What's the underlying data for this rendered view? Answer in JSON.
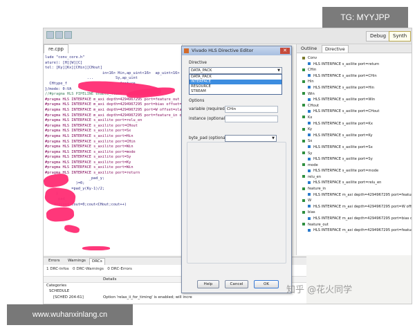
{
  "overlays": {
    "telegram": "TG: MYYJPP",
    "watermark": "知乎 @花火同学",
    "site": "www.wuhanxinlang.cn"
  },
  "toolbar": {
    "items": [
      "Debug",
      "Synth"
    ]
  },
  "editor": {
    "tab_label": "re.cpp",
    "lines": [
      "lude \"conv_core.h\"",
      "",
      "ature): [H][W][C]",
      "tel: [Ky][Kx][CHin][CHout]",
      "",
      "                          in<16> Hin,ap_uint<16>  ap_uint<16> ",
      "                   ...          Sy,ap_uint",
      "  CHtype_f                  ...   feature_",
      "}/mode: 0:VA",
      "",
      "//#pragma HLS PIPELINE enable_flush",
      "#pragma HLS INTERFACE m_axi depth=4294967295 port=feature_out offset",
      "#pragma HLS INTERFACE m_axi depth=4294967295 port=bias offset=slave",
      "#pragma HLS INTERFACE m_axi depth=4294967295 port=W offset=slave",
      "#pragma HLS INTERFACE m_axi depth=4294967295 port=feature_in offset",
      "#pragma HLS INTERFACE s_axilite port=relu_en",
      "#pragma HLS INTERFACE s_axilite port=CHout",
      "#pragma HLS INTERFACE s_axilite port=Sx",
      "#pragma HLS INTERFACE s_axilite port=Hin",
      "#pragma HLS INTERFACE s_axilite port=CHin",
      "#pragma HLS INTERFACE s_axilite port=Win",
      "#pragma HLS INTERFACE s_axilite port=mode",
      "#pragma HLS INTERFACE s_axilite port=Sy",
      "#pragma HLS INTERFACE s_axilite port=Ky",
      "#pragma HLS INTERFACE s_axilite port=Win",
      "#pragma HLS INTERFACE s_axilite port=return",
      "",
      "",
      "                    _pad_y;",
      "",
      "",
      "              )=0;",
      "",
      "",
      "            =pad_y(Ky-1)/2;",
      "     }",
      "",
      "      pad_",
      "",
      "",
      "    for(int cout=0;cout<CHout;cout++)"
    ]
  },
  "dialog": {
    "title": "Vivado HLS Directive Editor",
    "close_glyph": "✕",
    "directive_label": "Directive",
    "directive_value": "DATA_PACK",
    "dropdown_options": [
      "DATA_PACK",
      "INTERFACE",
      "RESOURCE",
      "STREAM"
    ],
    "selected_option": "INTERFACE",
    "options_label": "Options",
    "variable_label": "variable (required):",
    "variable_value": "CHin",
    "instance_label": "instance (optional):",
    "instance_value": "",
    "bytepad_label": "byte_pad (optional):",
    "bytepad_value": "",
    "buttons": {
      "help": "Help",
      "cancel": "Cancel",
      "ok": "OK"
    }
  },
  "outline": {
    "tabs": [
      "Outline",
      "Directive"
    ],
    "active_tab": "Directive",
    "root": "Conv",
    "items": [
      "HLS INTERFACE s_axilite port=return",
      "CHin",
      "HLS INTERFACE s_axilite port=CHin",
      "Hin",
      "HLS INTERFACE s_axilite port=Hin",
      "Win",
      "HLS INTERFACE s_axilite port=Win",
      "CHout",
      "HLS INTERFACE s_axilite port=CHout",
      "Kx",
      "HLS INTERFACE s_axilite port=Kx",
      "Ky",
      "HLS INTERFACE s_axilite port=Ky",
      "Sx",
      "HLS INTERFACE s_axilite port=Sx",
      "Sy",
      "HLS INTERFACE s_axilite port=Sy",
      "mode",
      "HLS INTERFACE s_axilite port=mode",
      "relu_en",
      "HLS INTERFACE s_axilite port=relu_en",
      "feature_in",
      "HLS INTERFACE m_axi depth=4294967295 port=feature",
      "W",
      "HLS INTERFACE m_axi depth=4294967295 port=W offs",
      "bias",
      "HLS INTERFACE m_axi depth=4294967295 port=bias o",
      "feature_out",
      "HLS INTERFACE m_axi depth=4294967295 port=featur"
    ]
  },
  "bottom": {
    "tabs": [
      "Errors",
      "Warnings",
      "DRCs"
    ],
    "active_tab": "DRCs",
    "filter_infos": "1 DRC-Infos",
    "filter_warnings": "0 DRC-Warnings",
    "filter_errors": "0 DRC-Errors",
    "column_details": "Details",
    "row_categories": "Categories",
    "row_schedule": "SCHEDULE",
    "row_sched_id": "[SCHED 204-61]",
    "row_sched_detail": "Option 'relax_ii_for_timing' is enabled; will incre"
  }
}
